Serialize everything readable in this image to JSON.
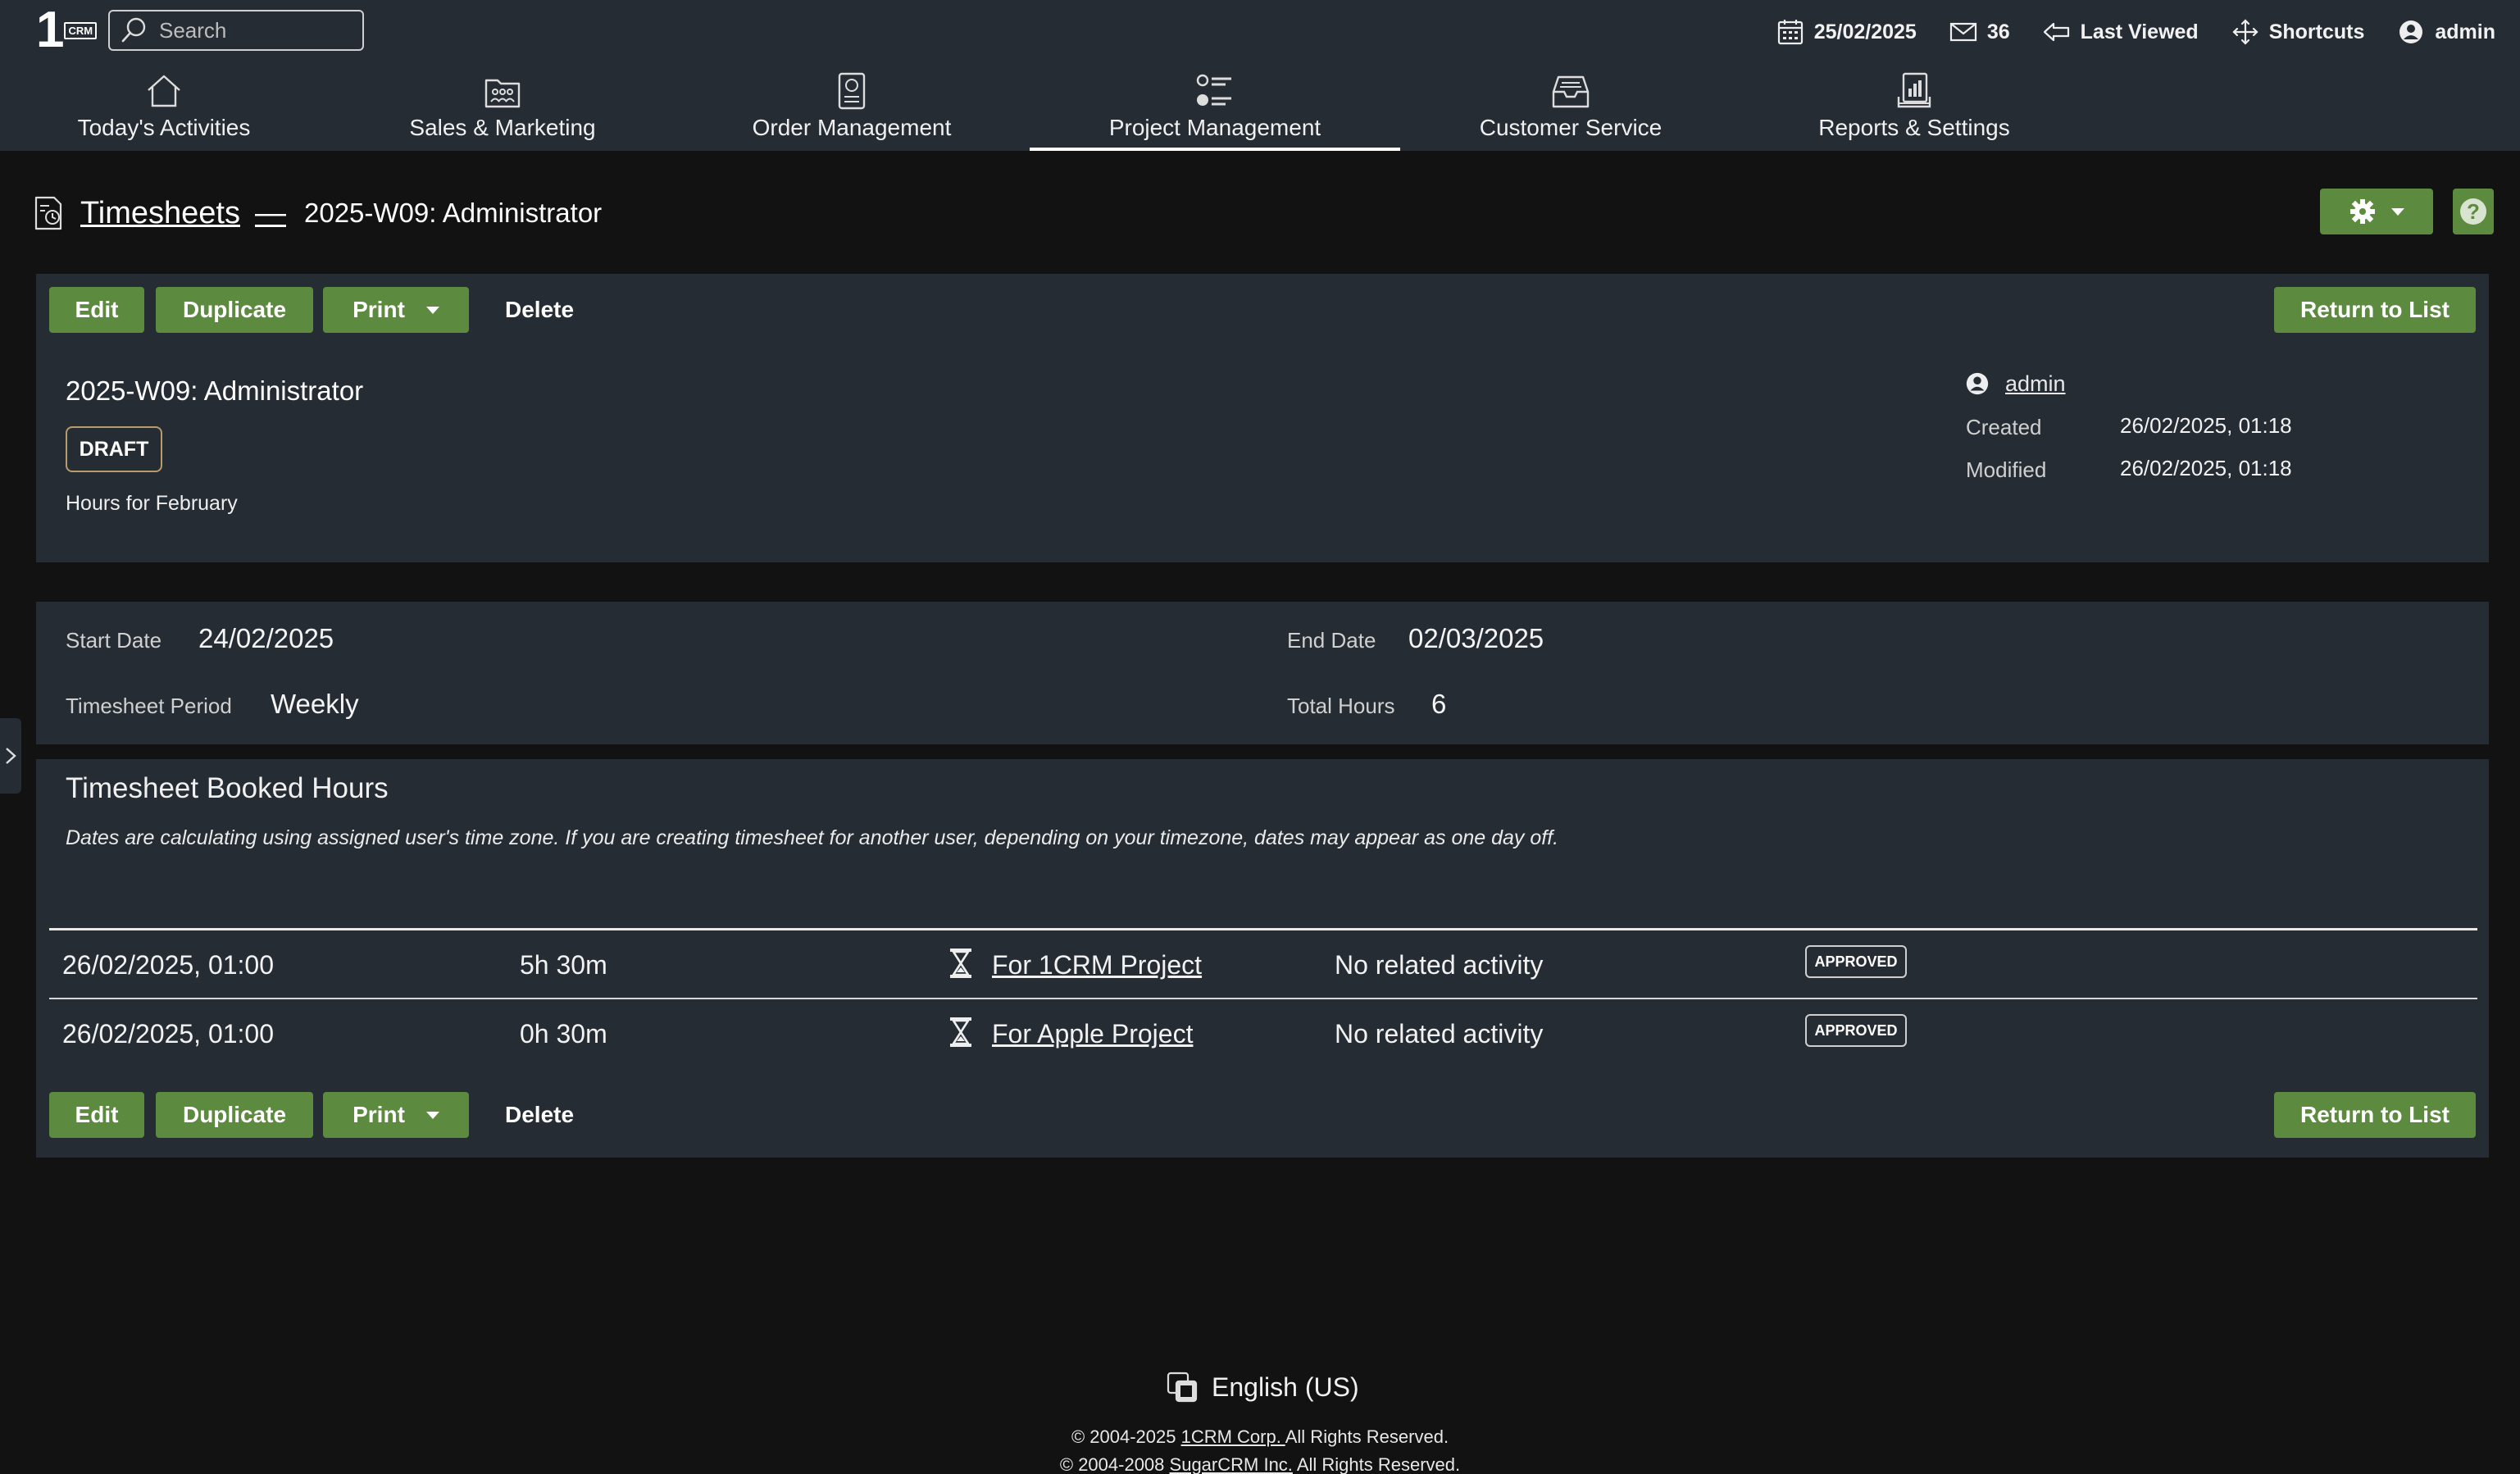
{
  "header": {
    "logo_main": "1",
    "logo_sub": "CRM",
    "search_placeholder": "Search",
    "date": "25/02/2025",
    "mail_count": "36",
    "last_viewed": "Last Viewed",
    "shortcuts": "Shortcuts",
    "user": "admin"
  },
  "nav": {
    "items": [
      {
        "label": "Today's Activities",
        "icon": "home-icon"
      },
      {
        "label": "Sales & Marketing",
        "icon": "people-folder-icon"
      },
      {
        "label": "Order Management",
        "icon": "money-document-icon"
      },
      {
        "label": "Project Management",
        "icon": "task-list-icon"
      },
      {
        "label": "Customer Service",
        "icon": "inbox-icon"
      },
      {
        "label": "Reports & Settings",
        "icon": "reports-icon"
      }
    ],
    "active": "Project Management"
  },
  "page": {
    "module": "Timesheets",
    "dash": "—",
    "record_title": "2025-W09: Administrator"
  },
  "actions": {
    "edit": "Edit",
    "duplicate": "Duplicate",
    "print": "Print",
    "delete": "Delete",
    "return": "Return to List"
  },
  "record": {
    "name": "2025-W09: Administrator",
    "status": "DRAFT",
    "description": "Hours for February",
    "owner": "admin",
    "created_label": "Created",
    "created": "26/02/2025, 01:18",
    "modified_label": "Modified",
    "modified": "26/02/2025, 01:18"
  },
  "fields": {
    "start_label": "Start Date",
    "start": "24/02/2025",
    "end_label": "End Date",
    "end": "02/03/2025",
    "period_label": "Timesheet Period",
    "period": "Weekly",
    "total_label": "Total Hours",
    "total": "6"
  },
  "booked": {
    "title": "Timesheet Booked Hours",
    "note": "Dates are calculating using assigned user's time zone. If you are creating timesheet for another user, depending on your timezone, dates may appear as one day off.",
    "rows": [
      {
        "date": "26/02/2025, 01:00",
        "duration": "5h 30m",
        "project": "For 1CRM Project",
        "related": "No related activity",
        "status": "APPROVED"
      },
      {
        "date": "26/02/2025, 01:00",
        "duration": "0h 30m",
        "project": "For Apple Project",
        "related": "No related activity",
        "status": "APPROVED"
      }
    ]
  },
  "footer": {
    "language": "English (US)",
    "copy1_pre": "© 2004-2025 ",
    "copy1_link": "1CRM Corp. ",
    "copy1_post": "All Rights Reserved.",
    "copy2_pre": "© 2004-2008 ",
    "copy2_link": "SugarCRM Inc.",
    "copy2_post": " All Rights Reserved."
  },
  "colors": {
    "topbar": "#262c33",
    "background": "#121212",
    "accent_green": "#5c8a3f",
    "panel": "#262c33"
  }
}
